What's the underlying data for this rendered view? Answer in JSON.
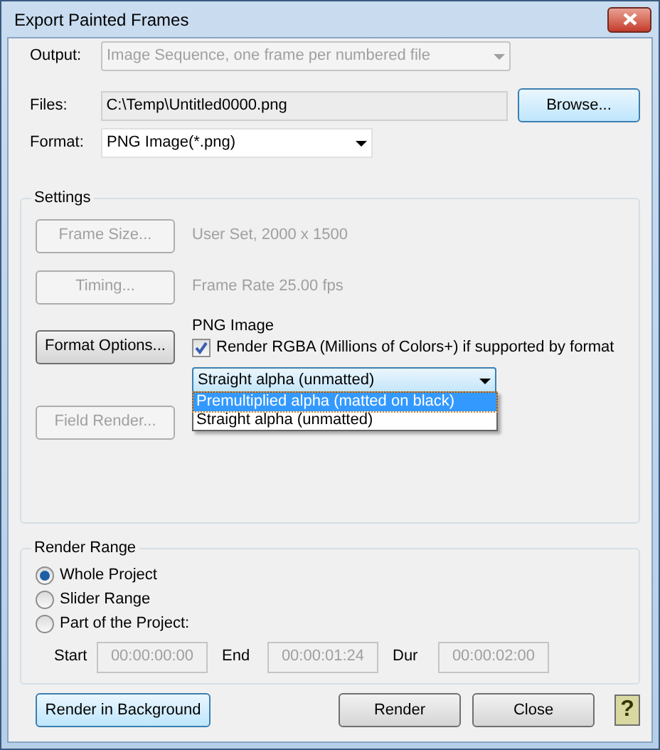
{
  "window": {
    "title": "Export Painted Frames"
  },
  "output": {
    "label": "Output:",
    "value": "Image Sequence, one frame per numbered file",
    "disabled": true
  },
  "files": {
    "label": "Files:",
    "value": "C:\\Temp\\Untitled0000.png",
    "browse_button": "Browse..."
  },
  "format": {
    "label": "Format:",
    "value": "PNG Image(*.png)"
  },
  "settings": {
    "title": "Settings",
    "rows": [
      {
        "button": "Frame Size...",
        "disabled": true,
        "info": "User Set, 2000 x 1500"
      },
      {
        "button": "Timing...",
        "disabled": true,
        "info": "Frame Rate 25.00 fps"
      }
    ],
    "format_options": {
      "button": "Format Options...",
      "disabled": false,
      "heading": "PNG Image",
      "checkbox": {
        "label": "Render RGBA (Millions of Colors+) if supported by format",
        "checked": true
      },
      "alpha_select": {
        "value": "Straight alpha (unmatted)",
        "expanded": true,
        "options": [
          {
            "label": "Premultiplied alpha (matted on black)",
            "highlighted": true
          },
          {
            "label": "Straight alpha (unmatted)",
            "highlighted": false
          }
        ]
      }
    },
    "field_render": {
      "button": "Field Render...",
      "disabled": true
    }
  },
  "render_range": {
    "title": "Render Range",
    "options": [
      {
        "label": "Whole Project",
        "selected": true
      },
      {
        "label": "Slider Range",
        "selected": false
      },
      {
        "label": "Part of the Project:",
        "selected": false
      }
    ],
    "fields": [
      {
        "label": "Start",
        "value": "00:00:00:00",
        "disabled": true
      },
      {
        "label": "End",
        "value": "00:00:01:24",
        "disabled": true
      },
      {
        "label": "Dur",
        "value": "00:00:02:00",
        "disabled": true
      }
    ]
  },
  "buttons": [
    {
      "label": "Render in Background",
      "focused": true
    },
    {
      "label": "Render",
      "focused": false
    },
    {
      "label": "Close",
      "focused": false
    }
  ],
  "help_button": "?"
}
